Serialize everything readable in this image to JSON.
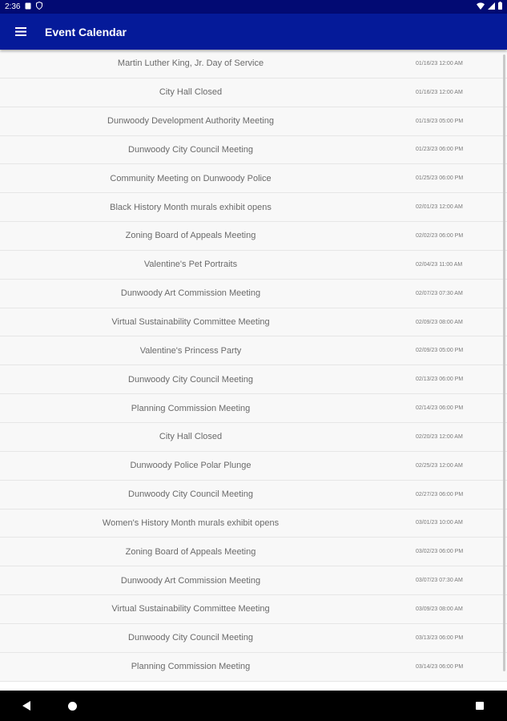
{
  "status_bar": {
    "time": "2:36",
    "icons": [
      "notification-icon",
      "shield-icon",
      "wifi-icon",
      "signal-icon",
      "battery-icon"
    ]
  },
  "app_bar": {
    "title": "Event Calendar",
    "menu_icon": "hamburger-menu-icon",
    "color": "#051a99"
  },
  "events": [
    {
      "name": "Martin Luther King, Jr. Day of Service",
      "date": "01/16/23 12:00 AM"
    },
    {
      "name": "City Hall Closed",
      "date": "01/16/23 12:00 AM"
    },
    {
      "name": "Dunwoody Development Authority Meeting",
      "date": "01/19/23 05:00 PM"
    },
    {
      "name": "Dunwoody City Council Meeting",
      "date": "01/23/23 06:00 PM"
    },
    {
      "name": "Community Meeting on Dunwoody Police",
      "date": "01/25/23 06:00 PM"
    },
    {
      "name": "Black History Month murals exhibit opens",
      "date": "02/01/23 12:00 AM"
    },
    {
      "name": "Zoning Board of Appeals Meeting",
      "date": "02/02/23 06:00 PM"
    },
    {
      "name": "Valentine's Pet Portraits",
      "date": "02/04/23 11:00 AM"
    },
    {
      "name": "Dunwoody Art Commission Meeting",
      "date": "02/07/23 07:30 AM"
    },
    {
      "name": "Virtual Sustainability Committee Meeting",
      "date": "02/09/23 08:00 AM"
    },
    {
      "name": "Valentine's Princess Party",
      "date": "02/09/23 05:00 PM"
    },
    {
      "name": "Dunwoody City Council Meeting",
      "date": "02/13/23 06:00 PM"
    },
    {
      "name": "Planning Commission Meeting",
      "date": "02/14/23 06:00 PM"
    },
    {
      "name": "City Hall Closed",
      "date": "02/20/23 12:00 AM"
    },
    {
      "name": "Dunwoody Police Polar Plunge",
      "date": "02/25/23 12:00 AM"
    },
    {
      "name": "Dunwoody City Council Meeting",
      "date": "02/27/23 06:00 PM"
    },
    {
      "name": "Women's History Month murals exhibit opens",
      "date": "03/01/23 10:00 AM"
    },
    {
      "name": "Zoning Board of Appeals Meeting",
      "date": "03/02/23 06:00 PM"
    },
    {
      "name": "Dunwoody Art Commission Meeting",
      "date": "03/07/23 07:30 AM"
    },
    {
      "name": "Virtual Sustainability Committee Meeting",
      "date": "03/09/23 08:00 AM"
    },
    {
      "name": "Dunwoody City Council Meeting",
      "date": "03/13/23 06:00 PM"
    },
    {
      "name": "Planning Commission Meeting",
      "date": "03/14/23 06:00 PM"
    }
  ],
  "nav_bar": {
    "icons": [
      "back-icon",
      "home-icon",
      "recents-icon"
    ]
  }
}
